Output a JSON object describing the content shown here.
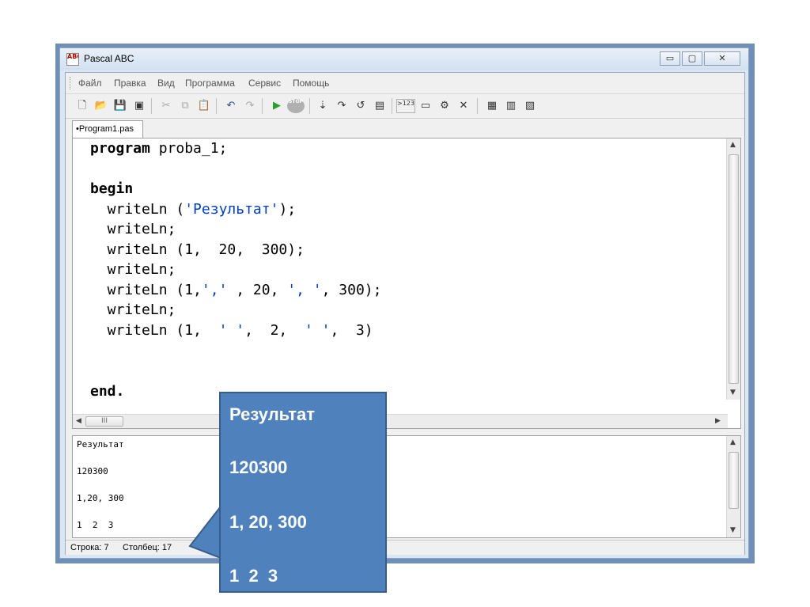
{
  "window": {
    "title": "Pascal ABC",
    "icon_text": "ABC",
    "buttons": {
      "minimize": "▭",
      "maximize": "▢",
      "close": "✕"
    }
  },
  "menu": {
    "items": [
      "Файл",
      "Правка",
      "Вид",
      "Программа",
      "Сервис",
      "Помощь"
    ]
  },
  "toolbar": {
    "icons": [
      "new-file-icon",
      "open-folder-icon",
      "save-icon",
      "save-all-icon",
      "cut-icon",
      "copy-icon",
      "paste-icon",
      "undo-icon",
      "redo-icon",
      "run-icon",
      "stop-icon",
      "step-into-icon",
      "step-over-icon",
      "step-out-icon",
      "watch-icon",
      "output-123-icon",
      "window-icon",
      "debug-icon",
      "close-icon",
      "format-icon",
      "compile-icon",
      "help-icon"
    ],
    "output_label": ">123",
    "stop_label": "STOP"
  },
  "tabs": [
    {
      "label": "•Program1.pas"
    }
  ],
  "editor": {
    "lines": [
      {
        "kw": "program",
        "rest": " proba_1;"
      },
      {
        "kw": "",
        "rest": ""
      },
      {
        "kw": "begin",
        "rest": ""
      },
      {
        "pre": "  writeLn (",
        "str": "'Результат'",
        "post": ");"
      },
      {
        "pre": "  writeLn;",
        "str": "",
        "post": ""
      },
      {
        "pre": "  writeLn (1,  20,  300);",
        "str": "",
        "post": ""
      },
      {
        "pre": "  writeLn;",
        "str": "",
        "post": ""
      },
      {
        "pre": "  writeLn (1,",
        "str": "','",
        "post": " , 20, ",
        "str2": "', '",
        "post2": ", 300);"
      },
      {
        "pre": "  writeLn;",
        "str": "",
        "post": ""
      },
      {
        "pre": "  writeLn (1,  ",
        "str": "' '",
        "post": ",  2,  ",
        "str2": "' '",
        "post2": ",  3)"
      },
      {
        "kw": "end.",
        "rest": ""
      }
    ],
    "hscroll_thumb": "III"
  },
  "output": {
    "lines": [
      "Результат",
      "120300",
      "1,20, 300",
      "1  2  3"
    ]
  },
  "status": {
    "row": "Строка: 7",
    "col": "Столбец: 17"
  },
  "callout": {
    "lines": [
      "Результат",
      "120300",
      "1, 20, 300",
      "1  2  3"
    ],
    "fill": "#4f81bd"
  }
}
